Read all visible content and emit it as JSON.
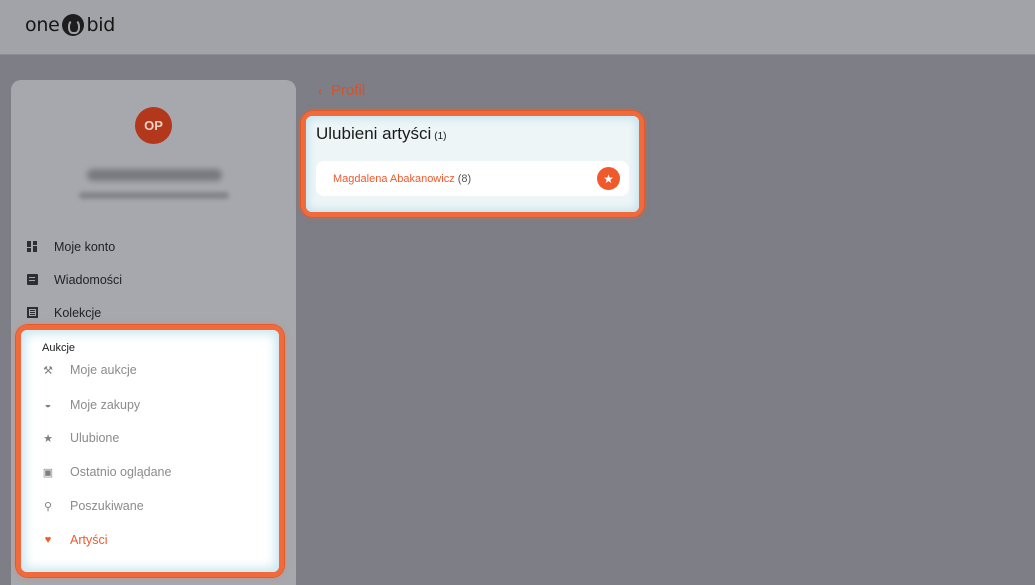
{
  "header": {
    "logo_left": "one",
    "logo_right": "bid"
  },
  "user": {
    "initials": "OP"
  },
  "menu": [
    {
      "label": "Moje konto",
      "icon": "dashboard-icon"
    },
    {
      "label": "Wiadomości",
      "icon": "chat-icon"
    },
    {
      "label": "Kolekcje",
      "icon": "collections-icon"
    }
  ],
  "auctions": {
    "title": "Aukcje",
    "items": [
      {
        "label": "Moje aukcje",
        "icon": "gavel-icon"
      },
      {
        "label": "Moje zakupy",
        "icon": "basket-icon"
      },
      {
        "label": "Ulubione",
        "icon": "star-icon"
      },
      {
        "label": "Ostatnio oglądane",
        "icon": "history-icon"
      },
      {
        "label": "Poszukiwane",
        "icon": "search-icon"
      },
      {
        "label": "Artyści",
        "icon": "heart-icon",
        "active": true
      }
    ]
  },
  "back": {
    "label": "Profil"
  },
  "favorites": {
    "title": "Ulubieni artyści",
    "count": "(1)",
    "artists": [
      {
        "name": "Magdalena Abakanowicz",
        "count": "(8)"
      }
    ]
  },
  "colors": {
    "accent": "#f0592b",
    "highlight": "#f16a3c"
  }
}
